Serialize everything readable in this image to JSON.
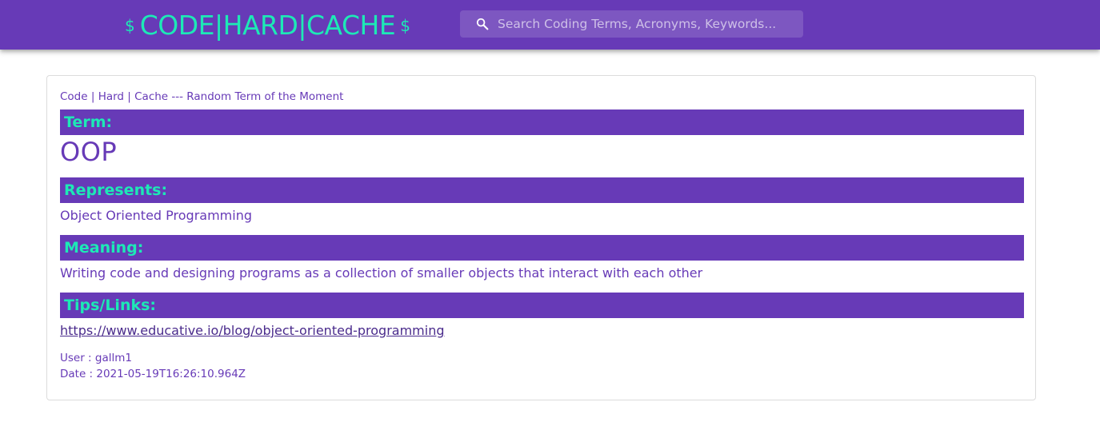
{
  "header": {
    "brand_left_symbol": "$",
    "brand_text": "CODE|HARD|CACHE",
    "brand_right_symbol": "$",
    "search": {
      "icon": "search-icon",
      "placeholder": "Search Coding Terms, Acronyms, Keywords...",
      "value": ""
    }
  },
  "card": {
    "title": "Code | Hard | Cache --- Random Term of the Moment",
    "term_label": "Term:",
    "term_value": "OOP",
    "represents_label": "Represents:",
    "represents_value": "Object Oriented Programming",
    "meaning_label": "Meaning:",
    "meaning_value": "Writing code and designing programs as a collection of smaller objects that interact with each other",
    "tips_label": "Tips/Links:",
    "tips_link": "https://www.educative.io/blog/object-oriented-programming",
    "user_line": "User : gallm1",
    "date_line": "Date : 2021-05-19T16:26:10.964Z"
  },
  "colors": {
    "primary": "#673ab7",
    "accent": "#1de9b6"
  }
}
